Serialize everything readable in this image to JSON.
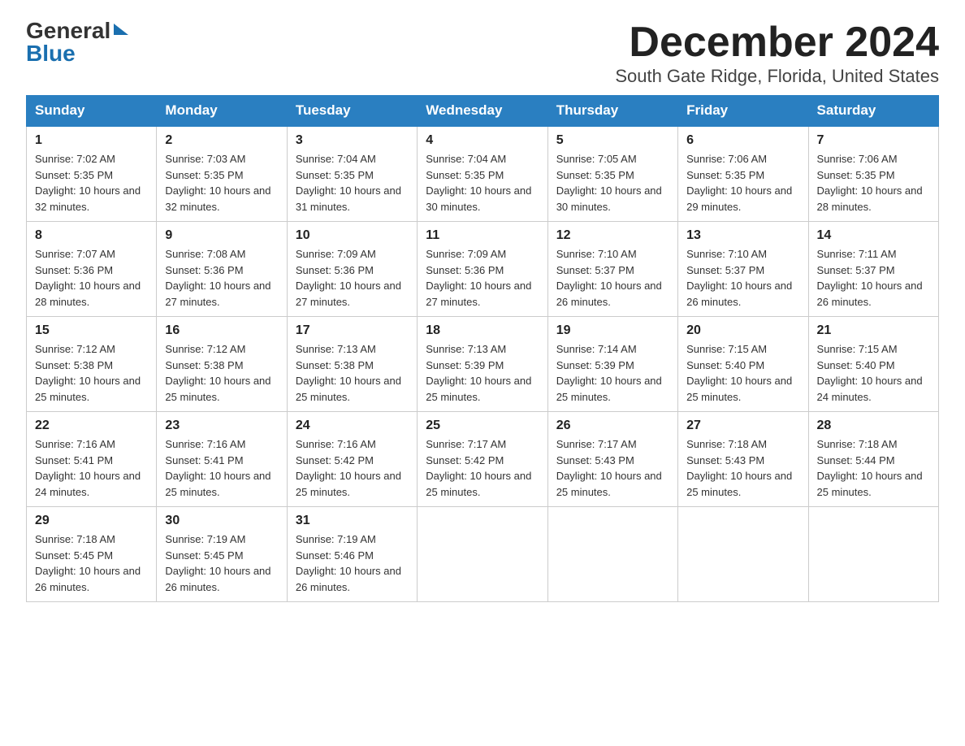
{
  "logo": {
    "general": "General",
    "blue": "Blue"
  },
  "title": "December 2024",
  "subtitle": "South Gate Ridge, Florida, United States",
  "days_of_week": [
    "Sunday",
    "Monday",
    "Tuesday",
    "Wednesday",
    "Thursday",
    "Friday",
    "Saturday"
  ],
  "weeks": [
    [
      {
        "day": "1",
        "sunrise": "7:02 AM",
        "sunset": "5:35 PM",
        "daylight": "10 hours and 32 minutes."
      },
      {
        "day": "2",
        "sunrise": "7:03 AM",
        "sunset": "5:35 PM",
        "daylight": "10 hours and 32 minutes."
      },
      {
        "day": "3",
        "sunrise": "7:04 AM",
        "sunset": "5:35 PM",
        "daylight": "10 hours and 31 minutes."
      },
      {
        "day": "4",
        "sunrise": "7:04 AM",
        "sunset": "5:35 PM",
        "daylight": "10 hours and 30 minutes."
      },
      {
        "day": "5",
        "sunrise": "7:05 AM",
        "sunset": "5:35 PM",
        "daylight": "10 hours and 30 minutes."
      },
      {
        "day": "6",
        "sunrise": "7:06 AM",
        "sunset": "5:35 PM",
        "daylight": "10 hours and 29 minutes."
      },
      {
        "day": "7",
        "sunrise": "7:06 AM",
        "sunset": "5:35 PM",
        "daylight": "10 hours and 28 minutes."
      }
    ],
    [
      {
        "day": "8",
        "sunrise": "7:07 AM",
        "sunset": "5:36 PM",
        "daylight": "10 hours and 28 minutes."
      },
      {
        "day": "9",
        "sunrise": "7:08 AM",
        "sunset": "5:36 PM",
        "daylight": "10 hours and 27 minutes."
      },
      {
        "day": "10",
        "sunrise": "7:09 AM",
        "sunset": "5:36 PM",
        "daylight": "10 hours and 27 minutes."
      },
      {
        "day": "11",
        "sunrise": "7:09 AM",
        "sunset": "5:36 PM",
        "daylight": "10 hours and 27 minutes."
      },
      {
        "day": "12",
        "sunrise": "7:10 AM",
        "sunset": "5:37 PM",
        "daylight": "10 hours and 26 minutes."
      },
      {
        "day": "13",
        "sunrise": "7:10 AM",
        "sunset": "5:37 PM",
        "daylight": "10 hours and 26 minutes."
      },
      {
        "day": "14",
        "sunrise": "7:11 AM",
        "sunset": "5:37 PM",
        "daylight": "10 hours and 26 minutes."
      }
    ],
    [
      {
        "day": "15",
        "sunrise": "7:12 AM",
        "sunset": "5:38 PM",
        "daylight": "10 hours and 25 minutes."
      },
      {
        "day": "16",
        "sunrise": "7:12 AM",
        "sunset": "5:38 PM",
        "daylight": "10 hours and 25 minutes."
      },
      {
        "day": "17",
        "sunrise": "7:13 AM",
        "sunset": "5:38 PM",
        "daylight": "10 hours and 25 minutes."
      },
      {
        "day": "18",
        "sunrise": "7:13 AM",
        "sunset": "5:39 PM",
        "daylight": "10 hours and 25 minutes."
      },
      {
        "day": "19",
        "sunrise": "7:14 AM",
        "sunset": "5:39 PM",
        "daylight": "10 hours and 25 minutes."
      },
      {
        "day": "20",
        "sunrise": "7:15 AM",
        "sunset": "5:40 PM",
        "daylight": "10 hours and 25 minutes."
      },
      {
        "day": "21",
        "sunrise": "7:15 AM",
        "sunset": "5:40 PM",
        "daylight": "10 hours and 24 minutes."
      }
    ],
    [
      {
        "day": "22",
        "sunrise": "7:16 AM",
        "sunset": "5:41 PM",
        "daylight": "10 hours and 24 minutes."
      },
      {
        "day": "23",
        "sunrise": "7:16 AM",
        "sunset": "5:41 PM",
        "daylight": "10 hours and 25 minutes."
      },
      {
        "day": "24",
        "sunrise": "7:16 AM",
        "sunset": "5:42 PM",
        "daylight": "10 hours and 25 minutes."
      },
      {
        "day": "25",
        "sunrise": "7:17 AM",
        "sunset": "5:42 PM",
        "daylight": "10 hours and 25 minutes."
      },
      {
        "day": "26",
        "sunrise": "7:17 AM",
        "sunset": "5:43 PM",
        "daylight": "10 hours and 25 minutes."
      },
      {
        "day": "27",
        "sunrise": "7:18 AM",
        "sunset": "5:43 PM",
        "daylight": "10 hours and 25 minutes."
      },
      {
        "day": "28",
        "sunrise": "7:18 AM",
        "sunset": "5:44 PM",
        "daylight": "10 hours and 25 minutes."
      }
    ],
    [
      {
        "day": "29",
        "sunrise": "7:18 AM",
        "sunset": "5:45 PM",
        "daylight": "10 hours and 26 minutes."
      },
      {
        "day": "30",
        "sunrise": "7:19 AM",
        "sunset": "5:45 PM",
        "daylight": "10 hours and 26 minutes."
      },
      {
        "day": "31",
        "sunrise": "7:19 AM",
        "sunset": "5:46 PM",
        "daylight": "10 hours and 26 minutes."
      },
      null,
      null,
      null,
      null
    ]
  ]
}
